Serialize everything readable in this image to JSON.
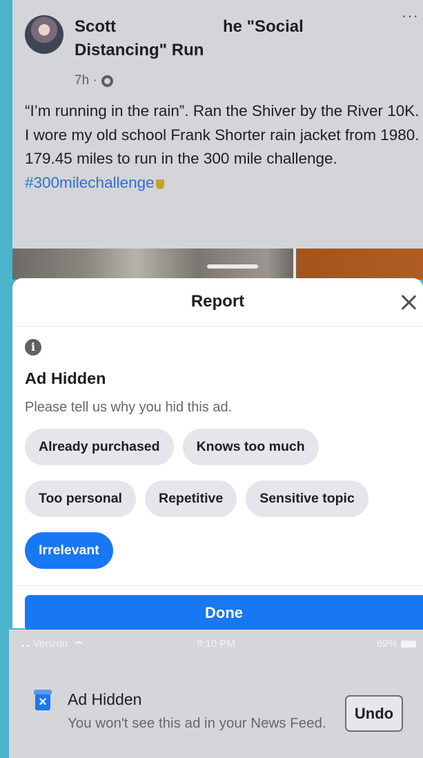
{
  "post": {
    "title_left": "Scott",
    "title_right": "he \"Social",
    "title_line2": "Distancing\" Run",
    "more_label": "···",
    "time": "7h ·",
    "body": "“I’m running in the rain”. Ran the Shiver by the River 10K. I wore my old school Frank Shorter rain jacket from 1980. 179.45 miles to run in the 300 mile challenge.",
    "hashtag": "#300milechallenge"
  },
  "report_sheet": {
    "title": "Report",
    "heading": "Ad Hidden",
    "subtitle": "Please tell us why you hid this ad.",
    "reasons": [
      {
        "label": "Already purchased",
        "selected": false
      },
      {
        "label": "Knows too much",
        "selected": false
      },
      {
        "label": "Too personal",
        "selected": false
      },
      {
        "label": "Repetitive",
        "selected": false
      },
      {
        "label": "Sensitive topic",
        "selected": false
      },
      {
        "label": "Irrelevant",
        "selected": true
      }
    ],
    "done_label": "Done"
  },
  "status_bar": {
    "carrier": "Verizon",
    "time": "9:10 PM",
    "battery": "69%"
  },
  "toast": {
    "title": "Ad Hidden",
    "message": "You won't see this ad in your News Feed.",
    "undo_label": "Undo"
  },
  "colors": {
    "accent": "#1877f2",
    "frame": "#4bb3cc",
    "chip": "#e4e6eb"
  }
}
